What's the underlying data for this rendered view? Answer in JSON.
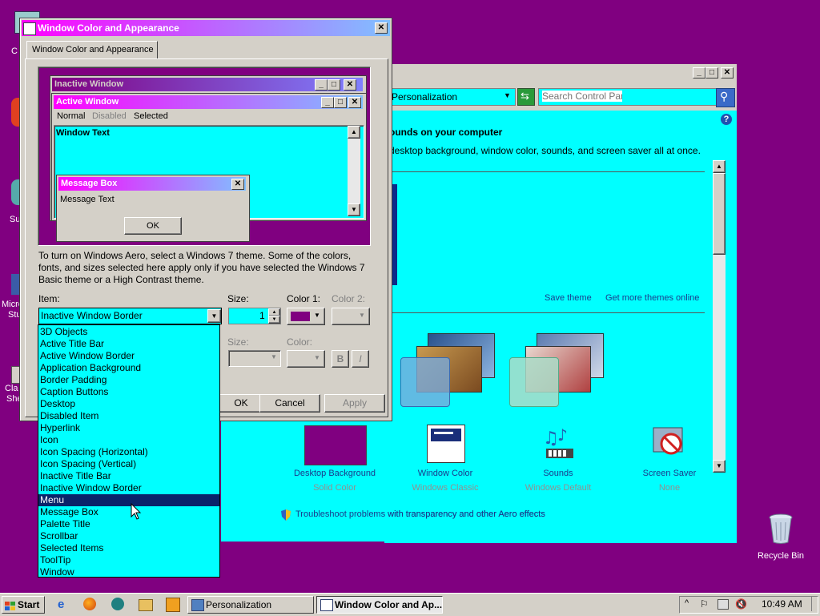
{
  "desktop": {
    "recycle_bin_label": "Recycle Bin",
    "left_icon_labels": [
      "C",
      "Su",
      "Micro",
      "Stu",
      "Cla",
      "She"
    ]
  },
  "personalization_window": {
    "address_label": "Personalization",
    "search_placeholder": "Search Control Panel",
    "heading": "ounds on your computer",
    "subheading": "desktop background, window color, sounds, and screen saver all at once.",
    "save_theme": "Save theme",
    "get_more_themes": "Get more themes online",
    "items": [
      {
        "title": "Desktop Background",
        "subtitle": "Solid Color",
        "icon": "desktop-background-icon"
      },
      {
        "title": "Window Color",
        "subtitle": "Windows Classic",
        "icon": "window-color-icon"
      },
      {
        "title": "Sounds",
        "subtitle": "Windows Default",
        "icon": "sounds-icon"
      },
      {
        "title": "Screen Saver",
        "subtitle": "None",
        "icon": "screen-saver-icon"
      }
    ],
    "troubleshoot_link": "Troubleshoot problems with transparency and other Aero effects"
  },
  "dialog": {
    "title": "Window Color and Appearance",
    "tab_label": "Window Color and Appearance",
    "preview": {
      "inactive_title": "Inactive Window",
      "active_title": "Active Window",
      "menu_normal": "Normal",
      "menu_disabled": "Disabled",
      "menu_selected": "Selected",
      "window_text": "Window Text",
      "message_box_title": "Message Box",
      "message_text": "Message Text",
      "ok_label": "OK"
    },
    "description": "To turn on Windows Aero, select a Windows 7 theme.  Some of the colors, fonts, and sizes selected here apply only if you have selected the Windows 7 Basic theme or a High Contrast theme.",
    "item_label": "Item:",
    "item_value": "Inactive Window Border",
    "size_label": "Size:",
    "size_value": "1",
    "color1_label": "Color 1:",
    "color2_label": "Color 2:",
    "font_size_label": "Size:",
    "font_color_label": "Color:",
    "bold_label": "B",
    "italic_label": "I",
    "ok_button": "OK",
    "cancel_button": "Cancel",
    "apply_button": "Apply",
    "dropdown_items": [
      "3D Objects",
      "Active Title Bar",
      "Active Window Border",
      "Application Background",
      "Border Padding",
      "Caption Buttons",
      "Desktop",
      "Disabled Item",
      "Hyperlink",
      "Icon",
      "Icon Spacing (Horizontal)",
      "Icon Spacing (Vertical)",
      "Inactive Title Bar",
      "Inactive Window Border",
      "Menu",
      "Message Box",
      "Palette Title",
      "Scrollbar",
      "Selected Items",
      "ToolTip",
      "Window"
    ],
    "dropdown_selected": "Menu"
  },
  "taskbar": {
    "start_label": "Start",
    "buttons": [
      "Personalization",
      "Window Color and Ap..."
    ],
    "clock": "10:49 AM"
  },
  "colors": {
    "desktop": "#800080",
    "window_background": "#00ffff",
    "active_title_start": "#ff00ff",
    "active_title_end": "#80c0ff",
    "inactive_title_start": "#800080",
    "inactive_title_end": "#8080ff",
    "selection": "#0a246a"
  }
}
